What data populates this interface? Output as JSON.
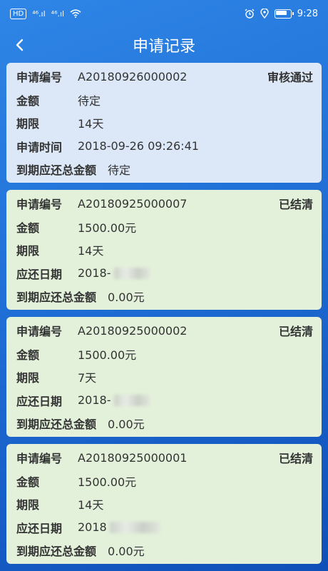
{
  "status_bar": {
    "hd": "HD",
    "signal1": "⁴⁶.ıl",
    "signal2": "⁴⁶.ıl",
    "time": "9:28"
  },
  "header": {
    "title": "申请记录"
  },
  "records": [
    {
      "id_label": "申请编号",
      "id": "A20180926000002",
      "status": "审核通过",
      "amount_label": "金额",
      "amount": "待定",
      "term_label": "期限",
      "term": "14天",
      "date_label": "申请时间",
      "date": "2018-09-26 09:26:41",
      "total_label": "到期应还总金额",
      "total": "待定"
    },
    {
      "id_label": "申请编号",
      "id": "A20180925000007",
      "status": "已结清",
      "amount_label": "金额",
      "amount": "1500.00元",
      "term_label": "期限",
      "term": "14天",
      "date_label": "应还日期",
      "date": "2018-",
      "total_label": "到期应还总金额",
      "total": "0.00元"
    },
    {
      "id_label": "申请编号",
      "id": "A20180925000002",
      "status": "已结清",
      "amount_label": "金额",
      "amount": "1500.00元",
      "term_label": "期限",
      "term": "7天",
      "date_label": "应还日期",
      "date": "2018-",
      "total_label": "到期应还总金额",
      "total": "0.00元"
    },
    {
      "id_label": "申请编号",
      "id": "A20180925000001",
      "status": "已结清",
      "amount_label": "金额",
      "amount": "1500.00元",
      "term_label": "期限",
      "term": "14天",
      "date_label": "应还日期",
      "date": "2018",
      "total_label": "到期应还总金额",
      "total": "0.00元"
    }
  ],
  "icons": [
    "hd-icon",
    "signal-icon",
    "wifi-icon",
    "alarm-icon",
    "location-icon",
    "battery-icon",
    "back-arrow-icon"
  ]
}
